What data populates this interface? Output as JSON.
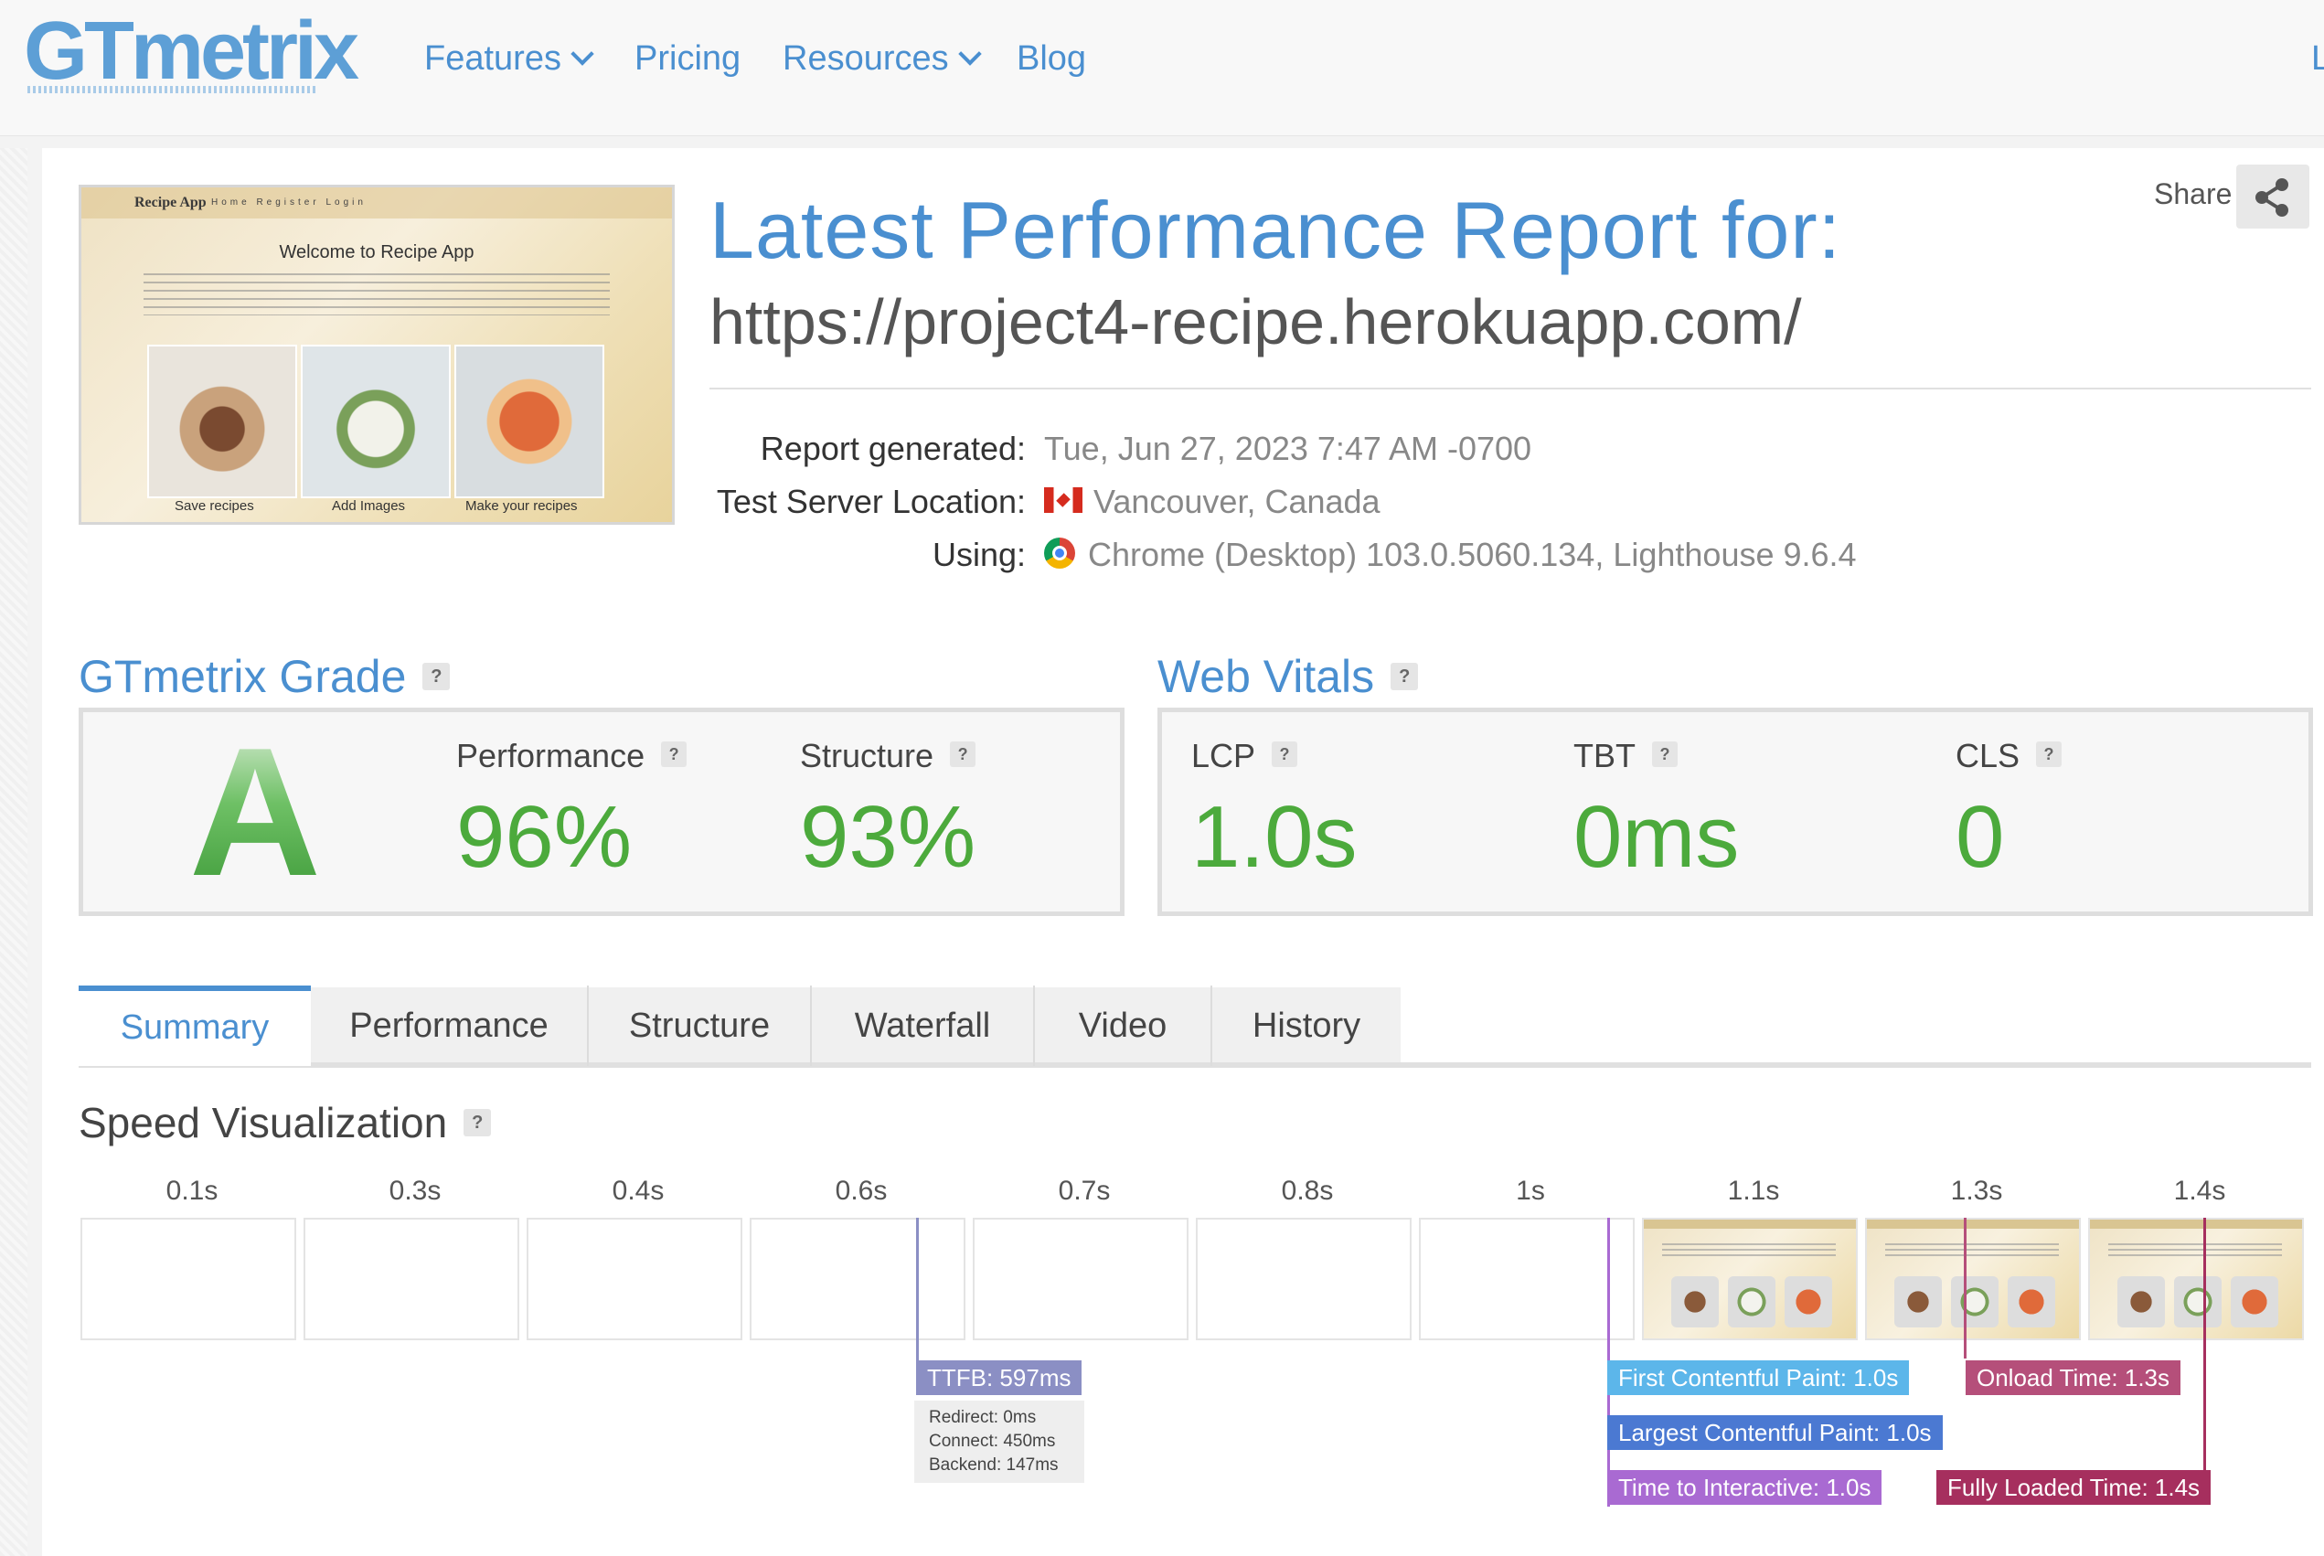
{
  "header": {
    "logo": "GTmetrix",
    "nav": [
      {
        "label": "Features",
        "has_dropdown": true
      },
      {
        "label": "Pricing",
        "has_dropdown": false
      },
      {
        "label": "Resources",
        "has_dropdown": true
      },
      {
        "label": "Blog",
        "has_dropdown": false
      }
    ],
    "right_partial": "L"
  },
  "report": {
    "title": "Latest Performance Report for:",
    "url": "https://project4-recipe.herokuapp.com/",
    "share_label": "Share",
    "meta": {
      "generated_label": "Report generated:",
      "generated_value": "Tue, Jun 27, 2023 7:47 AM -0700",
      "location_label": "Test Server Location:",
      "location_value": "Vancouver, Canada",
      "using_label": "Using:",
      "using_value": "Chrome (Desktop) 103.0.5060.134, Lighthouse 9.6.4"
    },
    "thumbnail": {
      "brand": "Recipe App",
      "menu": "Home  Register  Login",
      "heading": "Welcome to Recipe App",
      "captions": [
        "Save recipes",
        "Add Images",
        "Make your recipes"
      ]
    }
  },
  "grade": {
    "title": "GTmetrix Grade",
    "letter": "A",
    "performance_label": "Performance",
    "performance_value": "96%",
    "structure_label": "Structure",
    "structure_value": "93%"
  },
  "vitals": {
    "title": "Web Vitals",
    "items": [
      {
        "label": "LCP",
        "value": "1.0s"
      },
      {
        "label": "TBT",
        "value": "0ms"
      },
      {
        "label": "CLS",
        "value": "0"
      }
    ]
  },
  "tabs": [
    "Summary",
    "Performance",
    "Structure",
    "Waterfall",
    "Video",
    "History"
  ],
  "active_tab": "Summary",
  "speed": {
    "title": "Speed Visualization",
    "ticks": [
      "0.1s",
      "0.3s",
      "0.4s",
      "0.6s",
      "0.7s",
      "0.8s",
      "1s",
      "1.1s",
      "1.3s",
      "1.4s"
    ],
    "markers": {
      "ttfb": "TTFB: 597ms",
      "ttfb_redirect": "Redirect: 0ms",
      "ttfb_connect": "Connect: 450ms",
      "ttfb_backend": "Backend: 147ms",
      "fcp": "First Contentful Paint: 1.0s",
      "lcp": "Largest Contentful Paint: 1.0s",
      "tti": "Time to Interactive: 1.0s",
      "onload": "Onload Time: 1.3s",
      "fully_loaded": "Fully Loaded Time: 1.4s"
    }
  },
  "colors": {
    "brand_blue": "#4a8fd0",
    "grade_green": "#4caa3c",
    "ttfb": "#8b8fc4",
    "fcp": "#5cb6ea",
    "lcp": "#4b79d2",
    "tti": "#a96ad2",
    "onload": "#b54f7a",
    "fully_loaded": "#a62f5e"
  }
}
